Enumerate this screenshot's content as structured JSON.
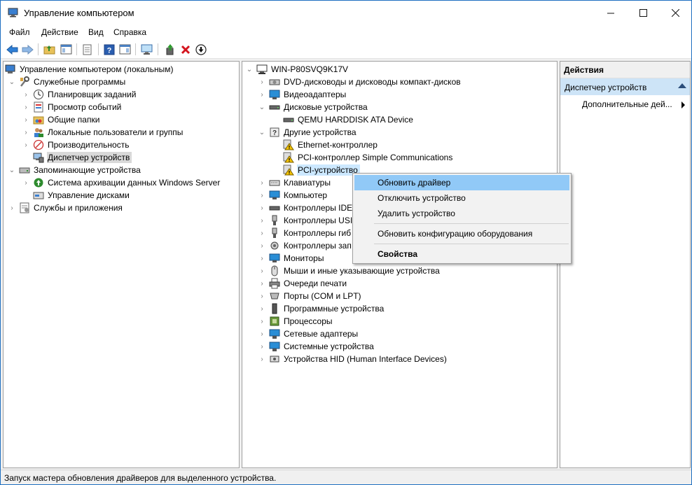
{
  "window": {
    "title": "Управление компьютером"
  },
  "menu": [
    "Файл",
    "Действие",
    "Вид",
    "Справка"
  ],
  "left_tree": {
    "root": "Управление компьютером (локальным)",
    "system_tools": "Служебные программы",
    "task_scheduler": "Планировщик заданий",
    "event_viewer": "Просмотр событий",
    "shared_folders": "Общие папки",
    "local_users": "Локальные пользователи и группы",
    "performance": "Производительность",
    "device_manager": "Диспетчер устройств",
    "storage": "Запоминающие устройства",
    "backup": "Система архивации данных Windows Server",
    "disk_management": "Управление дисками",
    "services_apps": "Службы и приложения"
  },
  "device_tree": {
    "computer": "WIN-P80SVQ9K17V",
    "dvd": "DVD-дисководы и дисководы компакт-дисков",
    "video": "Видеоадаптеры",
    "disks": "Дисковые устройства",
    "disk_item": "QEMU HARDDISK ATA Device",
    "other": "Другие устройства",
    "ethernet": "Ethernet-контроллер",
    "pci_simple": "PCI-контроллер Simple Communications",
    "pci_device": "PCI-устройство",
    "keyboards": "Клавиатуры",
    "computer_cat": "Компьютер",
    "ide": "Контроллеры IDE",
    "usb": "Контроллеры USI",
    "flex": "Контроллеры гиб",
    "storage_ctrl": "Контроллеры зап",
    "monitors": "Мониторы",
    "mice": "Мыши и иные указывающие устройства",
    "print_queues": "Очереди печати",
    "ports": "Порты (COM и LPT)",
    "software": "Программные устройства",
    "cpus": "Процессоры",
    "network": "Сетевые адаптеры",
    "system": "Системные устройства",
    "hid": "Устройства HID (Human Interface Devices)"
  },
  "context_menu": {
    "update_driver": "Обновить драйвер",
    "disable": "Отключить устройство",
    "uninstall": "Удалить устройство",
    "scan": "Обновить конфигурацию оборудования",
    "properties": "Свойства"
  },
  "actions": {
    "header": "Действия",
    "section": "Диспетчер устройств",
    "more": "Дополнительные дей..."
  },
  "status": "Запуск мастера обновления драйверов для выделенного устройства.",
  "colors": {
    "accent": "#cce8ff",
    "menu_highlight": "#91c9f7",
    "warning": "#f5c400"
  }
}
